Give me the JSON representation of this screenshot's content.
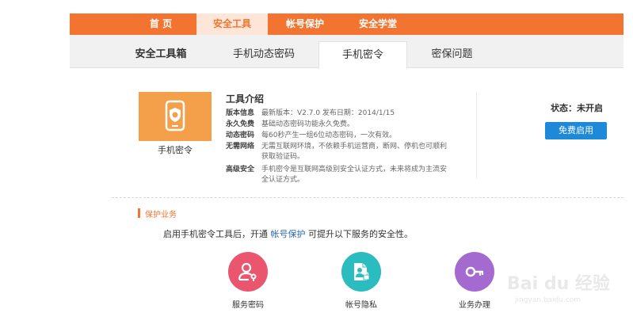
{
  "topnav": {
    "items": [
      {
        "label": "首 页"
      },
      {
        "label": "安全工具"
      },
      {
        "label": "帐号保护"
      },
      {
        "label": "安全学堂"
      }
    ]
  },
  "subtabs": {
    "items": [
      {
        "label": "安全工具箱"
      },
      {
        "label": "手机动态密码"
      },
      {
        "label": "手机密令"
      },
      {
        "label": "密保问题"
      }
    ]
  },
  "tool": {
    "name": "手机密令",
    "intro_title": "工具介绍",
    "rows": [
      {
        "label": "版本信息",
        "value": "最新版本：V2.7.0    发布日期：2014/1/15"
      },
      {
        "label": "永久免费",
        "value": "基础动态密码功能永久免费。"
      },
      {
        "label": "动态密码",
        "value": "每60秒产生一组6位动态密码，一次有效。"
      },
      {
        "label": "无需网络",
        "value": "无需互联网环境，不依赖手机运营商，断网、停机也可顺利获取验证码。"
      },
      {
        "label": "高级安全",
        "value": "手机密令是互联网高级别安全认证方式，未来将成为主流安全认证方式。"
      }
    ],
    "status": "状态：未开启",
    "enable_button": "免费启用"
  },
  "protection": {
    "title": "保护业务",
    "desc_before": "启用手机密令工具后，开通 ",
    "desc_link": "帐号保护",
    "desc_after": " 可提升以下服务的安全性。",
    "services": [
      {
        "label": "服务密码",
        "color": "#e9566e",
        "icon": "user-key-icon"
      },
      {
        "label": "帐号隐私",
        "color": "#2bbcc0",
        "icon": "document-lock-icon"
      },
      {
        "label": "业务办理",
        "color": "#a56ad0",
        "icon": "key-icon"
      }
    ]
  },
  "watermark": {
    "big": "Bai du 经验",
    "small": "jingyan.baidu.com"
  },
  "colors": {
    "accent": "#f27430",
    "button": "#1e88d9",
    "tile": "#f4a04a"
  }
}
